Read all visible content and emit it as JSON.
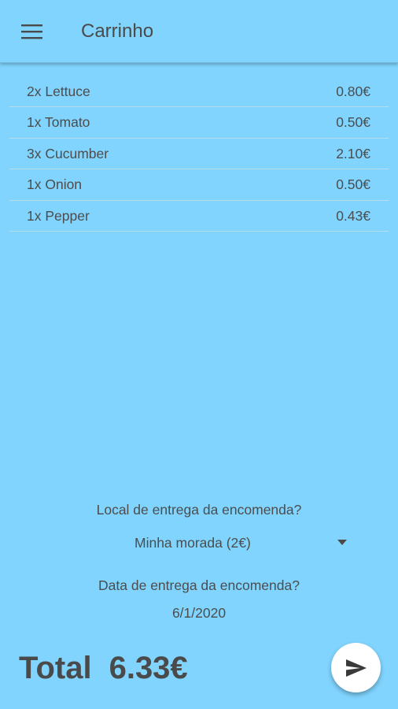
{
  "appbar": {
    "title": "Carrinho",
    "menu_icon": "hamburger-menu-icon"
  },
  "cart": {
    "items": [
      {
        "name": "2x Lettuce",
        "price": "0.80€"
      },
      {
        "name": "1x Tomato",
        "price": "0.50€"
      },
      {
        "name": "3x Cucumber",
        "price": "2.10€"
      },
      {
        "name": "1x Onion",
        "price": "0.50€"
      },
      {
        "name": "1x Pepper",
        "price": "0.43€"
      }
    ]
  },
  "delivery": {
    "location_question": "Local de entrega da encomenda?",
    "location_value": "Minha morada (2€)",
    "date_question": "Data de entrega da encomenda?",
    "date_value": "6/1/2020"
  },
  "footer": {
    "total_label": "Total",
    "total_value": "6.33€",
    "send_icon": "send-icon"
  },
  "colors": {
    "background": "#80d4fe",
    "text": "#4a4a4a",
    "fab": "#ffffff"
  }
}
